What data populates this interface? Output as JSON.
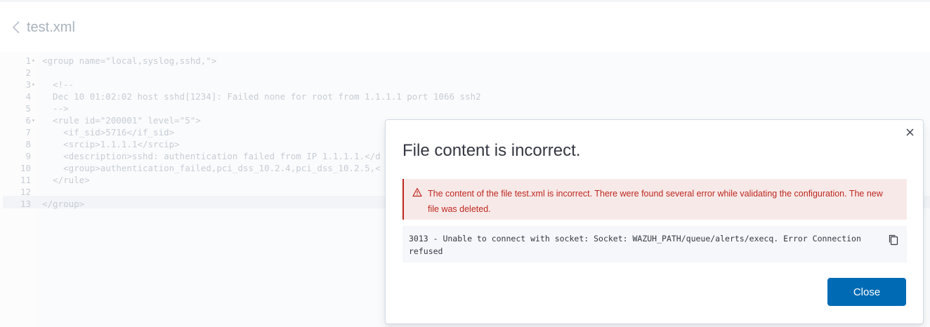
{
  "header": {
    "title": "test.xml"
  },
  "editor": {
    "lines": [
      {
        "num": "1",
        "fold": "▾",
        "text": "<group name=\"local,syslog,sshd,\">"
      },
      {
        "num": "2",
        "fold": "",
        "text": ""
      },
      {
        "num": "3",
        "fold": "▾",
        "text": "  <!--"
      },
      {
        "num": "4",
        "fold": "",
        "text": "  Dec 10 01:02:02 host sshd[1234]: Failed none for root from 1.1.1.1 port 1066 ssh2"
      },
      {
        "num": "5",
        "fold": "",
        "text": "  -->"
      },
      {
        "num": "6",
        "fold": "▾",
        "text": "  <rule id=\"200001\" level=\"5\">"
      },
      {
        "num": "7",
        "fold": "",
        "text": "    <if_sid>5716</if_sid>"
      },
      {
        "num": "8",
        "fold": "",
        "text": "    <srcip>1.1.1.1</srcip>"
      },
      {
        "num": "9",
        "fold": "",
        "text": "    <description>sshd: authentication failed from IP 1.1.1.1.</d"
      },
      {
        "num": "10",
        "fold": "",
        "text": "    <group>authentication_failed,pci_dss_10.2.4,pci_dss_10.2.5,<"
      },
      {
        "num": "11",
        "fold": "",
        "text": "  </rule>"
      },
      {
        "num": "12",
        "fold": "",
        "text": ""
      },
      {
        "num": "13",
        "fold": "",
        "text": "</group>"
      }
    ]
  },
  "modal": {
    "title": "File content is incorrect.",
    "error_message": "The content of the file test.xml is incorrect. There were found several error while validating the configuration. The new file was deleted.",
    "error_detail": "3013 - Unable to connect with socket: Socket: WAZUH_PATH/queue/alerts/execq. Error Connection refused",
    "close_label": "Close"
  },
  "colors": {
    "danger": "#bd271e",
    "danger_bg": "#f8e9e9",
    "primary": "#006bb4",
    "title_faded": "#aab3bd"
  }
}
